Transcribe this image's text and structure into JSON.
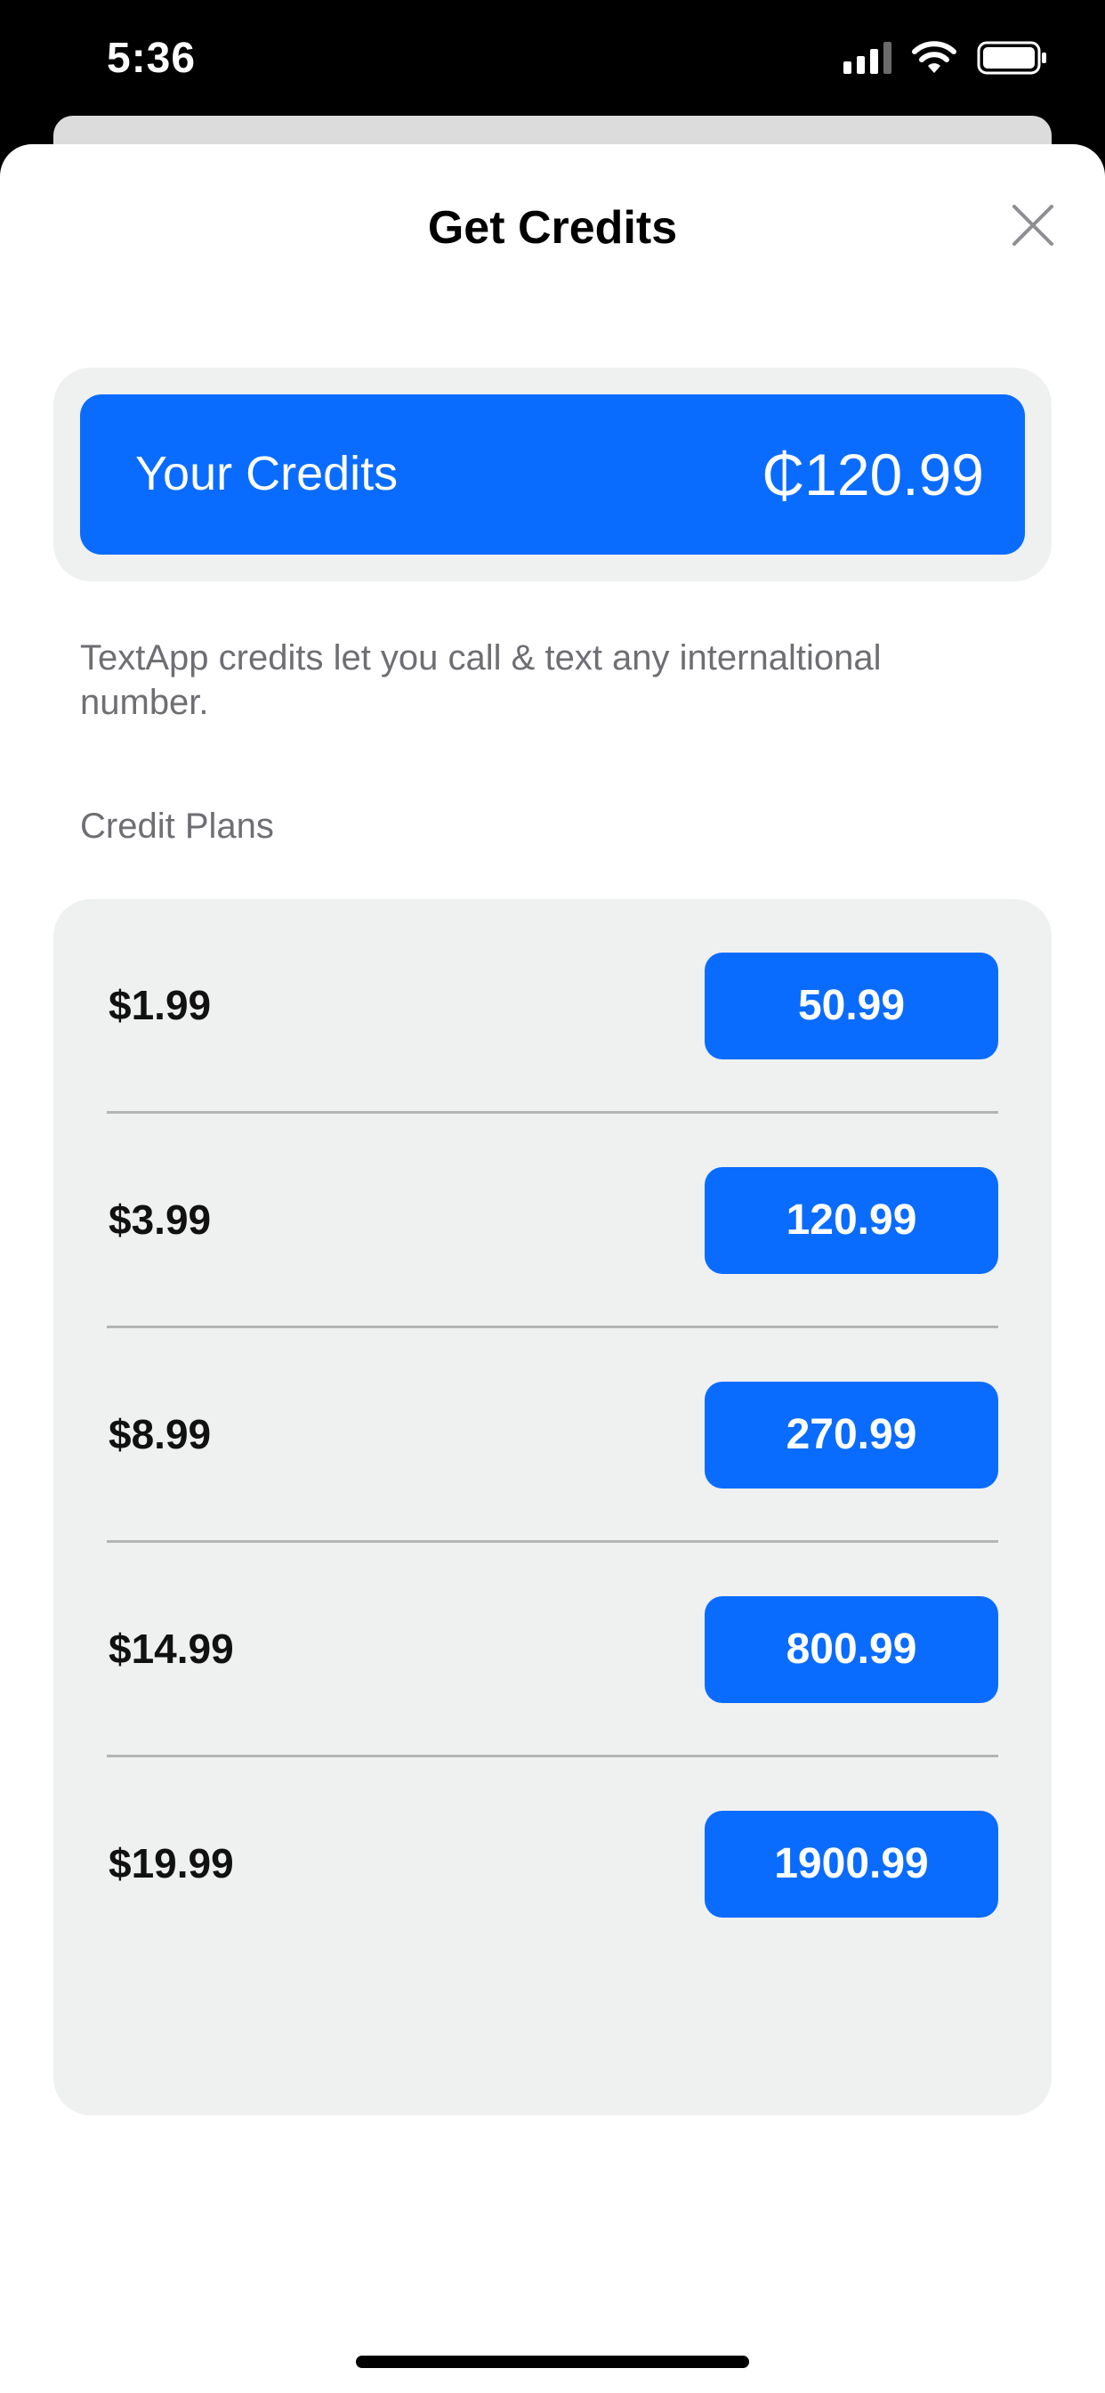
{
  "status_bar": {
    "time": "5:36"
  },
  "sheet": {
    "title": "Get Credits",
    "close_icon": "close-icon"
  },
  "credits": {
    "label": "Your Credits",
    "amount": "₵120.99"
  },
  "description": "TextApp credits let you call & text any internaltional number.",
  "plans": {
    "section_label": "Credit Plans",
    "items": [
      {
        "price": "$1.99",
        "credits": "50.99"
      },
      {
        "price": "$3.99",
        "credits": "120.99"
      },
      {
        "price": "$8.99",
        "credits": "270.99"
      },
      {
        "price": "$14.99",
        "credits": "800.99"
      },
      {
        "price": "$19.99",
        "credits": "1900.99"
      }
    ]
  },
  "colors": {
    "accent": "#0a6cff",
    "card_background": "#eff0f0",
    "secondary_text": "#6e6e73"
  }
}
